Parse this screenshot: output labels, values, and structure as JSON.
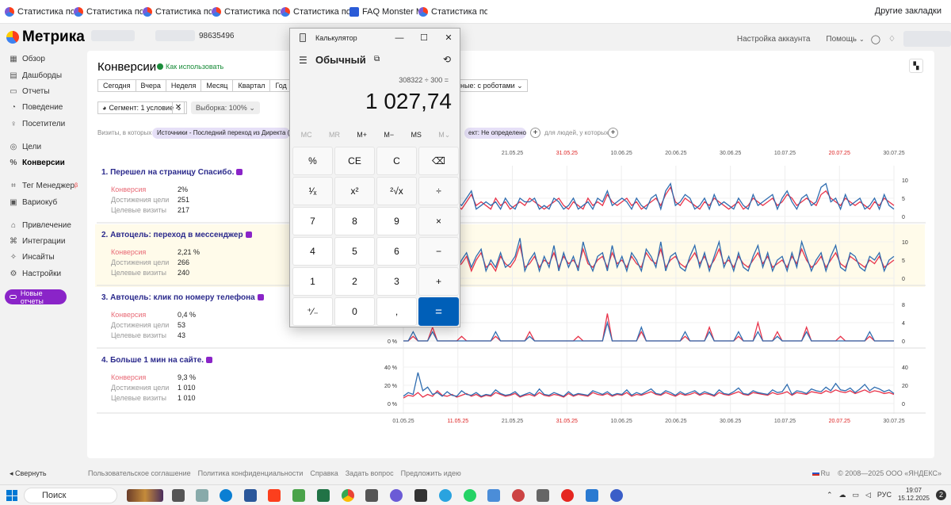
{
  "bookmarks": {
    "items": [
      {
        "label": "Статистика по вы",
        "icon": "metrica-icon"
      },
      {
        "label": "Статистика по вы",
        "icon": "metrica-icon"
      },
      {
        "label": "Статистика по вы",
        "icon": "metrica-icon"
      },
      {
        "label": "Статистика по вы",
        "icon": "metrica-icon"
      },
      {
        "label": "Статистика по вы",
        "icon": "metrica-icon"
      },
      {
        "label": "FAQ Monster Mar",
        "icon": "faq-icon"
      },
      {
        "label": "Статистика по вы",
        "icon": "metrica-icon"
      }
    ],
    "other": "Другие закладки"
  },
  "app": {
    "logo": "Метрика",
    "counter_id": "98635496"
  },
  "header": {
    "account_settings": "Настройка аккаунта",
    "help": "Помощь"
  },
  "sidebar": {
    "items": [
      {
        "label": "Обзор",
        "icon": "grid-icon"
      },
      {
        "label": "Дашборды",
        "icon": "dashboard-icon"
      },
      {
        "label": "Отчеты",
        "icon": "reports-icon"
      },
      {
        "label": "Поведение",
        "icon": "behavior-icon"
      },
      {
        "label": "Посетители",
        "icon": "visitors-icon"
      },
      {
        "label": "Цели",
        "icon": "target-icon"
      },
      {
        "label": "Конверсии",
        "icon": "percent-icon"
      },
      {
        "label": "Тег Менеджер",
        "icon": "tag-icon",
        "badge": "β"
      },
      {
        "label": "Вариокуб",
        "icon": "variocube-icon"
      },
      {
        "label": "Привлечение",
        "icon": "attraction-icon"
      },
      {
        "label": "Интеграции",
        "icon": "integrations-icon"
      },
      {
        "label": "Инсайты",
        "icon": "insights-icon"
      },
      {
        "label": "Настройки",
        "icon": "settings-icon"
      }
    ],
    "new_reports": "Новые отчеты"
  },
  "page": {
    "title": "Конверсии",
    "howto": "Как использовать",
    "periods": [
      "Сегодня",
      "Вчера",
      "Неделя",
      "Месяц",
      "Квартал",
      "Год"
    ],
    "segment": "Сегмент: 1 условие",
    "sample": "Выборка: 100%",
    "robots": "ные: с роботами",
    "visits_label": "Визиты, в которых",
    "filter_chip": "Источники - Последний переход из Директа (Кросс",
    "filter_chip2": "ект: Не определено",
    "people_label": "для людей, у которых"
  },
  "goals": [
    {
      "title": "1. Перешел на страницу Спасибо.",
      "conv_label": "Конверсия",
      "conv": "2%",
      "reach_label": "Достижения цели",
      "reach": "251",
      "visits_label": "Целевые визиты",
      "visits": "217"
    },
    {
      "title": "2. Автоцель: переход в мессенджер",
      "conv_label": "Конверсия",
      "conv": "2,21 %",
      "reach_label": "Достижения цели",
      "reach": "266",
      "visits_label": "Целевые визиты",
      "visits": "240"
    },
    {
      "title": "3. Автоцель: клик по номеру телефона",
      "conv_label": "Конверсия",
      "conv": "0,4 %",
      "reach_label": "Достижения цели",
      "reach": "53",
      "visits_label": "Целевые визиты",
      "visits": "43"
    },
    {
      "title": "4. Больше 1 мин на сайте.",
      "conv_label": "Конверсия",
      "conv": "9,3 %",
      "reach_label": "Достижения цели",
      "reach": "1 010",
      "visits_label": "Целевые визиты",
      "visits": "1 010"
    }
  ],
  "chart_data": {
    "type": "line",
    "x_ticks": [
      {
        "label": "01.05.25",
        "red": false
      },
      {
        "label": "11.05.25",
        "red": true
      },
      {
        "label": "21.05.25",
        "red": false
      },
      {
        "label": "31.05.25",
        "red": true
      },
      {
        "label": "10.06.25",
        "red": false
      },
      {
        "label": "20.06.25",
        "red": false
      },
      {
        "label": "30.06.25",
        "red": false
      },
      {
        "label": "10.07.25",
        "red": false
      },
      {
        "label": "20.07.25",
        "red": true
      },
      {
        "label": "30.07.25",
        "red": false
      }
    ],
    "colors": {
      "series_a": "#e8334a",
      "series_b": "#2f6db0"
    },
    "panels": [
      {
        "right_ticks": [
          "10",
          "5",
          "0"
        ],
        "left_ticks": [],
        "ymax": 10,
        "a": [
          2,
          3,
          4,
          2,
          5,
          3,
          2,
          4,
          3,
          5,
          4,
          3,
          2,
          4,
          6,
          3,
          4,
          3,
          2,
          5,
          3,
          4,
          2,
          3,
          4,
          3,
          5,
          4,
          3,
          2,
          3,
          4,
          5,
          3,
          2,
          4,
          3,
          2,
          5,
          3,
          4,
          3,
          6,
          4,
          3,
          4,
          5,
          3,
          4,
          2,
          3,
          4,
          5,
          3,
          6,
          8,
          4,
          3,
          5,
          4,
          3,
          2,
          4,
          3,
          5,
          4,
          3,
          2,
          3,
          4,
          2,
          3,
          5,
          4,
          3,
          4,
          5,
          3,
          4,
          6,
          5,
          3,
          4,
          5,
          4,
          3,
          6,
          7,
          5,
          4,
          3,
          5,
          4,
          3,
          4,
          3,
          2,
          4,
          3,
          5,
          4,
          3
        ],
        "b": [
          3,
          2,
          5,
          3,
          4,
          2,
          3,
          5,
          4,
          6,
          3,
          4,
          3,
          5,
          7,
          2,
          3,
          4,
          3,
          4,
          2,
          5,
          3,
          2,
          5,
          4,
          4,
          5,
          2,
          3,
          2,
          5,
          4,
          2,
          3,
          5,
          2,
          3,
          4,
          2,
          5,
          4,
          7,
          3,
          4,
          5,
          4,
          2,
          5,
          3,
          2,
          5,
          6,
          2,
          7,
          9,
          3,
          4,
          6,
          5,
          2,
          3,
          5,
          2,
          6,
          3,
          4,
          3,
          2,
          5,
          3,
          2,
          6,
          3,
          4,
          5,
          6,
          2,
          5,
          7,
          4,
          2,
          5,
          6,
          3,
          4,
          8,
          9,
          4,
          5,
          2,
          6,
          3,
          4,
          5,
          2,
          3,
          5,
          2,
          6,
          3,
          2
        ]
      },
      {
        "right_ticks": [
          "10",
          "5",
          "0"
        ],
        "left_ticks": [],
        "ymax": 10,
        "a": [
          3,
          5,
          2,
          4,
          6,
          3,
          7,
          4,
          3,
          8,
          5,
          3,
          4,
          6,
          2,
          5,
          7,
          3,
          4,
          2,
          6,
          4,
          3,
          5,
          9,
          3,
          4,
          6,
          3,
          5,
          4,
          7,
          3,
          6,
          4,
          5,
          3,
          8,
          4,
          3,
          5,
          6,
          3,
          7,
          4,
          5,
          3,
          6,
          4,
          3,
          7,
          5,
          4,
          8,
          3,
          5,
          6,
          4,
          3,
          5,
          7,
          4,
          6,
          3,
          5,
          8,
          4,
          5,
          3,
          6,
          4,
          3,
          5,
          7,
          4,
          6,
          3,
          4,
          5,
          3,
          6,
          4,
          8,
          5,
          3,
          4,
          6,
          3,
          5,
          7,
          4,
          3,
          6,
          5,
          4,
          3,
          5,
          4,
          6,
          3,
          4,
          5
        ],
        "b": [
          4,
          6,
          3,
          5,
          8,
          2,
          6,
          3,
          4,
          9,
          6,
          2,
          5,
          7,
          3,
          6,
          8,
          2,
          5,
          3,
          7,
          3,
          4,
          6,
          11,
          2,
          5,
          7,
          2,
          6,
          3,
          9,
          2,
          7,
          3,
          6,
          2,
          10,
          5,
          2,
          6,
          7,
          2,
          9,
          3,
          6,
          2,
          7,
          5,
          2,
          8,
          6,
          3,
          10,
          2,
          6,
          7,
          3,
          2,
          6,
          9,
          3,
          7,
          2,
          6,
          10,
          3,
          6,
          2,
          7,
          3,
          2,
          6,
          9,
          3,
          7,
          2,
          5,
          6,
          2,
          7,
          3,
          10,
          6,
          2,
          5,
          7,
          2,
          6,
          9,
          3,
          2,
          7,
          6,
          3,
          2,
          6,
          5,
          7,
          2,
          5,
          6
        ]
      },
      {
        "right_ticks": [
          "8",
          "4",
          "0"
        ],
        "left_ticks": [
          "0 %"
        ],
        "ymax": 8,
        "a": [
          0,
          0,
          1,
          0,
          0,
          0,
          3,
          0,
          0,
          0,
          0,
          0,
          1,
          0,
          0,
          0,
          0,
          0,
          0,
          1,
          0,
          0,
          0,
          0,
          0,
          0,
          2,
          0,
          0,
          0,
          0,
          0,
          0,
          0,
          0,
          0,
          1,
          0,
          0,
          0,
          0,
          0,
          6,
          0,
          0,
          0,
          0,
          0,
          0,
          2,
          0,
          0,
          0,
          0,
          0,
          0,
          0,
          0,
          1,
          0,
          0,
          0,
          0,
          3,
          0,
          0,
          0,
          0,
          0,
          1,
          0,
          0,
          0,
          4,
          0,
          0,
          0,
          2,
          0,
          0,
          0,
          0,
          0,
          3,
          0,
          0,
          0,
          0,
          0,
          0,
          1,
          0,
          0,
          0,
          0,
          0,
          1,
          0,
          0,
          0,
          0,
          0
        ],
        "b": [
          0,
          0,
          2,
          0,
          0,
          0,
          2,
          0,
          0,
          0,
          0,
          0,
          0,
          0,
          0,
          0,
          0,
          0,
          0,
          2,
          0,
          0,
          0,
          0,
          0,
          0,
          1,
          0,
          0,
          0,
          0,
          0,
          0,
          0,
          0,
          0,
          0,
          0,
          0,
          0,
          0,
          0,
          4,
          0,
          0,
          0,
          0,
          0,
          0,
          3,
          0,
          0,
          0,
          0,
          0,
          0,
          0,
          0,
          2,
          0,
          0,
          0,
          0,
          2,
          0,
          0,
          0,
          0,
          0,
          2,
          0,
          0,
          0,
          2,
          0,
          0,
          0,
          1,
          0,
          0,
          0,
          0,
          0,
          2,
          0,
          0,
          0,
          0,
          0,
          0,
          0,
          0,
          0,
          0,
          0,
          0,
          2,
          0,
          0,
          0,
          0,
          0
        ]
      },
      {
        "right_ticks": [
          "40",
          "20",
          "0"
        ],
        "left_ticks": [
          "40 %",
          "20 %",
          "0 %"
        ],
        "ymax": 40,
        "a": [
          6,
          9,
          8,
          12,
          7,
          10,
          8,
          14,
          9,
          8,
          10,
          7,
          9,
          11,
          8,
          10,
          7,
          9,
          8,
          12,
          10,
          8,
          9,
          11,
          7,
          9,
          10,
          8,
          12,
          9,
          8,
          10,
          9,
          7,
          11,
          8,
          10,
          9,
          8,
          12,
          10,
          9,
          11,
          8,
          10,
          9,
          12,
          8,
          10,
          9,
          11,
          13,
          10,
          9,
          12,
          10,
          8,
          11,
          9,
          10,
          12,
          9,
          11,
          10,
          8,
          12,
          10,
          9,
          11,
          13,
          10,
          9,
          12,
          11,
          10,
          9,
          12,
          10,
          11,
          13,
          9,
          12,
          11,
          10,
          13,
          12,
          11,
          14,
          12,
          15,
          13,
          12,
          14,
          11,
          13,
          15,
          12,
          14,
          13,
          11,
          12,
          10
        ],
        "b": [
          8,
          12,
          10,
          34,
          14,
          18,
          10,
          12,
          8,
          13,
          9,
          8,
          14,
          10,
          9,
          12,
          8,
          10,
          9,
          15,
          11,
          9,
          10,
          13,
          8,
          10,
          12,
          9,
          16,
          10,
          9,
          12,
          10,
          8,
          13,
          9,
          11,
          10,
          9,
          14,
          12,
          10,
          13,
          9,
          11,
          10,
          15,
          9,
          12,
          10,
          13,
          16,
          11,
          10,
          14,
          12,
          9,
          13,
          10,
          12,
          14,
          10,
          13,
          11,
          9,
          15,
          11,
          10,
          13,
          17,
          11,
          10,
          14,
          12,
          11,
          10,
          15,
          12,
          13,
          21,
          10,
          14,
          13,
          11,
          16,
          14,
          13,
          18,
          14,
          22,
          15,
          14,
          17,
          12,
          16,
          21,
          14,
          18,
          16,
          13,
          15,
          11
        ]
      }
    ]
  },
  "footer": {
    "collapse": "Свернуть",
    "links": [
      "Пользовательское соглашение",
      "Политика конфиденциальности",
      "Справка",
      "Задать вопрос",
      "Предложить идею"
    ],
    "lang": "Ru",
    "copyright": "© 2008—2025 ООО «ЯНДЕКС»"
  },
  "taskbar": {
    "search": "Поиск",
    "lang": "РУС",
    "time": "19:07",
    "date": "15.12.2025",
    "notif": "2"
  },
  "calculator": {
    "window_title": "Калькулятор",
    "mode": "Обычный",
    "expression": "308322 ÷ 300 =",
    "result": "1 027,74",
    "memory": [
      "MC",
      "MR",
      "M+",
      "M−",
      "MS",
      "M⌄"
    ],
    "memory_disabled": [
      true,
      true,
      false,
      false,
      false,
      true
    ],
    "keys": [
      "%",
      "CE",
      "C",
      "⌫",
      "¹⁄ₓ",
      "x²",
      "²√x",
      "÷",
      "7",
      "8",
      "9",
      "×",
      "4",
      "5",
      "6",
      "−",
      "1",
      "2",
      "3",
      "+",
      "⁺⁄₋",
      "0",
      ",",
      "="
    ]
  }
}
